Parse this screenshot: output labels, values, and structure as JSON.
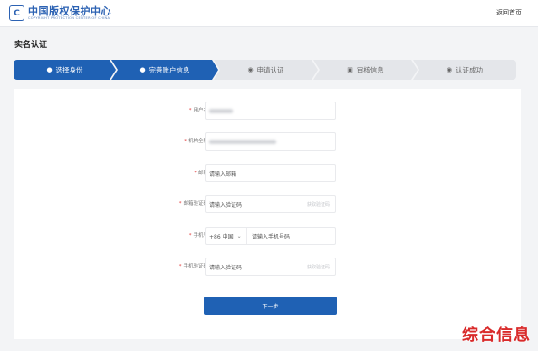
{
  "header": {
    "logo_mark": "C",
    "logo_cn": "中国版权保护中心",
    "logo_en": "COPYRIGHT PROTECTION CENTER OF CHINA",
    "back_home": "返回首页"
  },
  "page_title": "实名认证",
  "steps": [
    {
      "label": "选择身份",
      "icon": "user-icon",
      "glyph": "●",
      "active": true
    },
    {
      "label": "完善账户信息",
      "icon": "user-edit-icon",
      "glyph": "●",
      "active": true
    },
    {
      "label": "申请认证",
      "icon": "apply-icon",
      "glyph": "◉",
      "active": false
    },
    {
      "label": "审核信息",
      "icon": "document-icon",
      "glyph": "▣",
      "active": false
    },
    {
      "label": "认证成功",
      "icon": "success-icon",
      "glyph": "◉",
      "active": false
    }
  ],
  "form": {
    "username": {
      "label": "用户名",
      "required": "*"
    },
    "org_name": {
      "label": "机构全称",
      "required": "*"
    },
    "email": {
      "label": "邮箱",
      "required": "*",
      "placeholder": "请输入邮箱"
    },
    "email_code": {
      "label": "邮箱验证码",
      "required": "*",
      "placeholder": "请输入验证码",
      "suffix": "获取验证码"
    },
    "phone": {
      "label": "手机号",
      "required": "*",
      "area_code": "+86 中国",
      "placeholder": "请输入手机号码"
    },
    "phone_code": {
      "label": "手机验证码",
      "required": "*",
      "placeholder": "请输入验证码",
      "suffix": "获取验证码"
    }
  },
  "next_button": "下一步",
  "watermark": "综合信息",
  "colors": {
    "primary": "#1f61b4",
    "step_inactive": "#e4e6ea",
    "required": "#e23c3c",
    "watermark": "#d92b2b"
  }
}
